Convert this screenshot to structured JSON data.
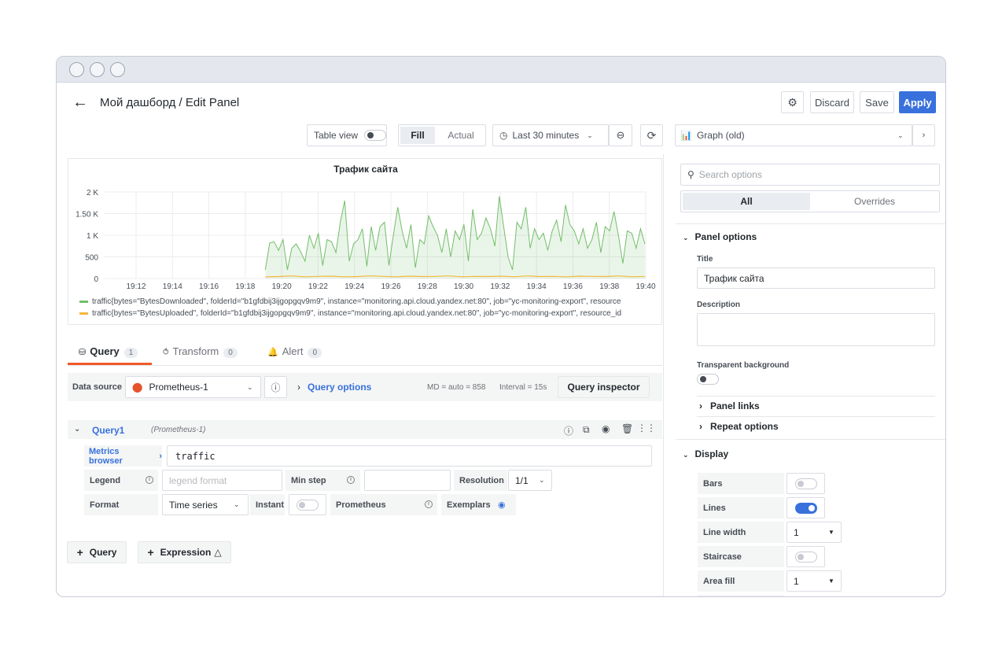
{
  "header": {
    "title": "Мой дашборд / Edit Panel",
    "discard_label": "Discard",
    "save_label": "Save",
    "apply_label": "Apply"
  },
  "toolbar": {
    "table_view_label": "Table view",
    "fill_label": "Fill",
    "actual_label": "Actual",
    "time_range_label": "Last 30 minutes",
    "visualization_label": "Graph (old)"
  },
  "chart_data": {
    "type": "line",
    "title": "Трафик сайта",
    "x": [
      "19:12",
      "19:14",
      "19:16",
      "19:18",
      "19:20",
      "19:22",
      "19:24",
      "19:26",
      "19:28",
      "19:30",
      "19:32",
      "19:34",
      "19:36",
      "19:38",
      "19:40"
    ],
    "y_ticks": [
      "0",
      "500",
      "1 K",
      "1.50 K",
      "2 K"
    ],
    "ylim": [
      0,
      2000
    ],
    "series": [
      {
        "name": "traffic{bytes=\"BytesDownloaded\", folderId=\"b1gfdbij3ijgopgqv9m9\", instance=\"monitoring.api.cloud.yandex.net:80\", job=\"yc-monitoring-export\", resource",
        "color": "#73bf69",
        "values": [
          200,
          820,
          850,
          650,
          900,
          200,
          700,
          800,
          620,
          400,
          1000,
          700,
          1050,
          300,
          900,
          850,
          600,
          1300,
          1800,
          400,
          800,
          900,
          1150,
          280,
          1200,
          650,
          1200,
          1300,
          300,
          1000,
          1650,
          1100,
          700,
          1250,
          250,
          900,
          800,
          1450,
          1200,
          1000,
          600,
          1150,
          500,
          1100,
          900,
          1250,
          400,
          1600,
          900,
          1050,
          1400,
          1150,
          750,
          1900,
          1200,
          500,
          200,
          1300,
          1150,
          1650,
          700,
          1150,
          900,
          1050,
          650,
          1100,
          1350,
          850,
          1700,
          1250,
          1100,
          800,
          1150,
          700,
          900,
          1300,
          600,
          1200,
          1100,
          1550,
          1000,
          350,
          1100,
          1050,
          700,
          1150,
          800
        ]
      },
      {
        "name": "traffic{bytes=\"BytesUploaded\", folderId=\"b1gfdbij3ijgopgqv9m9\", instance=\"monitoring.api.cloud.yandex.net:80\", job=\"yc-monitoring-export\", resource_id",
        "color": "#f2b83c",
        "values": [
          40,
          45,
          60,
          40,
          50,
          55,
          40,
          45,
          60,
          50,
          40,
          55,
          45,
          50,
          60,
          40,
          50,
          45,
          55,
          40,
          60,
          45,
          50,
          40,
          55,
          50,
          45,
          60,
          40,
          50
        ]
      }
    ]
  },
  "query_tabs": [
    {
      "label": "Query",
      "count": "1"
    },
    {
      "label": "Transform",
      "count": "0"
    },
    {
      "label": "Alert",
      "count": "0"
    }
  ],
  "datasource": {
    "label": "Data source",
    "value": "Prometheus-1",
    "query_options_label": "Query options",
    "md_text": "MD = auto = 858",
    "interval_text": "Interval = 15s",
    "inspector_label": "Query inspector"
  },
  "query": {
    "name": "Query1",
    "source": "(Prometheus-1)",
    "metrics_browser_label": "Metrics browser",
    "expression": "traffic",
    "legend_label": "Legend",
    "legend_placeholder": "legend format",
    "min_step_label": "Min step",
    "resolution_label": "Resolution",
    "resolution_value": "1/1",
    "format_label": "Format",
    "format_value": "Time series",
    "instant_label": "Instant",
    "prometheus_label": "Prometheus",
    "exemplars_label": "Exemplars"
  },
  "add_buttons": {
    "query_label": "Query",
    "expression_label": "Expression"
  },
  "options": {
    "search_placeholder": "Search options",
    "tab_all": "All",
    "tab_overrides": "Overrides",
    "panel_options_label": "Panel options",
    "title_label": "Title",
    "title_value": "Трафик сайта",
    "description_label": "Description",
    "transparent_label": "Transparent background",
    "panel_links_label": "Panel links",
    "repeat_options_label": "Repeat options",
    "display_label": "Display",
    "bars_label": "Bars",
    "lines_label": "Lines",
    "line_width_label": "Line width",
    "line_width_value": "1",
    "staircase_label": "Staircase",
    "area_fill_label": "Area fill",
    "area_fill_value": "1"
  }
}
